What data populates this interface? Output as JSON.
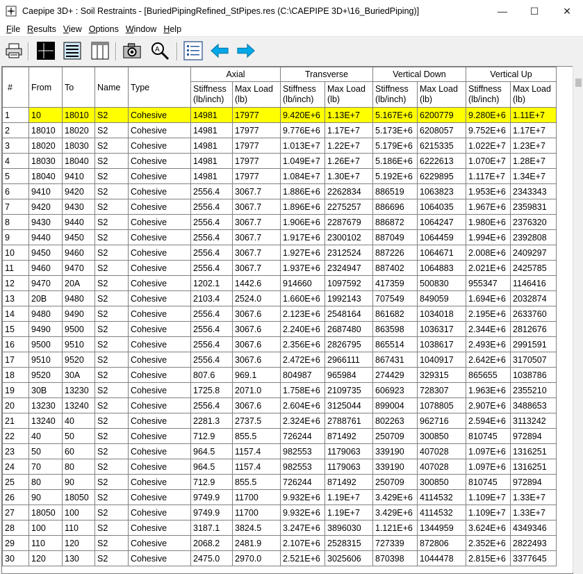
{
  "window": {
    "title": "Caepipe 3D+ : Soil Restraints -  [BuriedPipingRefined_StPipes.res (C:\\CAEPIPE 3D+\\16_BuriedPiping)]",
    "minimize": "—",
    "maximize": "☐",
    "close": "✕"
  },
  "menu": [
    "File",
    "Results",
    "View",
    "Options",
    "Window",
    "Help"
  ],
  "toolbar_icons": [
    "printer-icon",
    "grid-lines-icon",
    "document-list-icon",
    "columns-icon",
    "camera-icon",
    "zoom-icon",
    "list-icon",
    "arrow-left-icon",
    "arrow-right-icon"
  ],
  "table": {
    "headers": {
      "num": "#",
      "from": "From",
      "to": "To",
      "name": "Name",
      "type": "Type",
      "axial": "Axial",
      "transverse": "Transverse",
      "vdown": "Vertical Down",
      "vup": "Vertical Up",
      "stiffness": "Stiffness (lb/inch)",
      "maxload": "Max Load (lb)"
    },
    "rows": [
      [
        "1",
        "10",
        "18010",
        "S2",
        "Cohesive",
        "14981",
        "17977",
        "9.420E+6",
        "1.13E+7",
        "5.167E+6",
        "6200779",
        "9.280E+6",
        "1.11E+7"
      ],
      [
        "2",
        "18010",
        "18020",
        "S2",
        "Cohesive",
        "14981",
        "17977",
        "9.776E+6",
        "1.17E+7",
        "5.173E+6",
        "6208057",
        "9.752E+6",
        "1.17E+7"
      ],
      [
        "3",
        "18020",
        "18030",
        "S2",
        "Cohesive",
        "14981",
        "17977",
        "1.013E+7",
        "1.22E+7",
        "5.179E+6",
        "6215335",
        "1.022E+7",
        "1.23E+7"
      ],
      [
        "4",
        "18030",
        "18040",
        "S2",
        "Cohesive",
        "14981",
        "17977",
        "1.049E+7",
        "1.26E+7",
        "5.186E+6",
        "6222613",
        "1.070E+7",
        "1.28E+7"
      ],
      [
        "5",
        "18040",
        "9410",
        "S2",
        "Cohesive",
        "14981",
        "17977",
        "1.084E+7",
        "1.30E+7",
        "5.192E+6",
        "6229895",
        "1.117E+7",
        "1.34E+7"
      ],
      [
        "6",
        "9410",
        "9420",
        "S2",
        "Cohesive",
        "2556.4",
        "3067.7",
        "1.886E+6",
        "2262834",
        "886519",
        "1063823",
        "1.953E+6",
        "2343343"
      ],
      [
        "7",
        "9420",
        "9430",
        "S2",
        "Cohesive",
        "2556.4",
        "3067.7",
        "1.896E+6",
        "2275257",
        "886696",
        "1064035",
        "1.967E+6",
        "2359831"
      ],
      [
        "8",
        "9430",
        "9440",
        "S2",
        "Cohesive",
        "2556.4",
        "3067.7",
        "1.906E+6",
        "2287679",
        "886872",
        "1064247",
        "1.980E+6",
        "2376320"
      ],
      [
        "9",
        "9440",
        "9450",
        "S2",
        "Cohesive",
        "2556.4",
        "3067.7",
        "1.917E+6",
        "2300102",
        "887049",
        "1064459",
        "1.994E+6",
        "2392808"
      ],
      [
        "10",
        "9450",
        "9460",
        "S2",
        "Cohesive",
        "2556.4",
        "3067.7",
        "1.927E+6",
        "2312524",
        "887226",
        "1064671",
        "2.008E+6",
        "2409297"
      ],
      [
        "11",
        "9460",
        "9470",
        "S2",
        "Cohesive",
        "2556.4",
        "3067.7",
        "1.937E+6",
        "2324947",
        "887402",
        "1064883",
        "2.021E+6",
        "2425785"
      ],
      [
        "12",
        "9470",
        "20A",
        "S2",
        "Cohesive",
        "1202.1",
        "1442.6",
        "914660",
        "1097592",
        "417359",
        "500830",
        "955347",
        "1146416"
      ],
      [
        "13",
        "20B",
        "9480",
        "S2",
        "Cohesive",
        "2103.4",
        "2524.0",
        "1.660E+6",
        "1992143",
        "707549",
        "849059",
        "1.694E+6",
        "2032874"
      ],
      [
        "14",
        "9480",
        "9490",
        "S2",
        "Cohesive",
        "2556.4",
        "3067.6",
        "2.123E+6",
        "2548164",
        "861682",
        "1034018",
        "2.195E+6",
        "2633760"
      ],
      [
        "15",
        "9490",
        "9500",
        "S2",
        "Cohesive",
        "2556.4",
        "3067.6",
        "2.240E+6",
        "2687480",
        "863598",
        "1036317",
        "2.344E+6",
        "2812676"
      ],
      [
        "16",
        "9500",
        "9510",
        "S2",
        "Cohesive",
        "2556.4",
        "3067.6",
        "2.356E+6",
        "2826795",
        "865514",
        "1038617",
        "2.493E+6",
        "2991591"
      ],
      [
        "17",
        "9510",
        "9520",
        "S2",
        "Cohesive",
        "2556.4",
        "3067.6",
        "2.472E+6",
        "2966111",
        "867431",
        "1040917",
        "2.642E+6",
        "3170507"
      ],
      [
        "18",
        "9520",
        "30A",
        "S2",
        "Cohesive",
        "807.6",
        "969.1",
        "804987",
        "965984",
        "274429",
        "329315",
        "865655",
        "1038786"
      ],
      [
        "19",
        "30B",
        "13230",
        "S2",
        "Cohesive",
        "1725.8",
        "2071.0",
        "1.758E+6",
        "2109735",
        "606923",
        "728307",
        "1.963E+6",
        "2355210"
      ],
      [
        "20",
        "13230",
        "13240",
        "S2",
        "Cohesive",
        "2556.4",
        "3067.6",
        "2.604E+6",
        "3125044",
        "899004",
        "1078805",
        "2.907E+6",
        "3488653"
      ],
      [
        "21",
        "13240",
        "40",
        "S2",
        "Cohesive",
        "2281.3",
        "2737.5",
        "2.324E+6",
        "2788761",
        "802263",
        "962716",
        "2.594E+6",
        "3113242"
      ],
      [
        "22",
        "40",
        "50",
        "S2",
        "Cohesive",
        "712.9",
        "855.5",
        "726244",
        "871492",
        "250709",
        "300850",
        "810745",
        "972894"
      ],
      [
        "23",
        "50",
        "60",
        "S2",
        "Cohesive",
        "964.5",
        "1157.4",
        "982553",
        "1179063",
        "339190",
        "407028",
        "1.097E+6",
        "1316251"
      ],
      [
        "24",
        "70",
        "80",
        "S2",
        "Cohesive",
        "964.5",
        "1157.4",
        "982553",
        "1179063",
        "339190",
        "407028",
        "1.097E+6",
        "1316251"
      ],
      [
        "25",
        "80",
        "90",
        "S2",
        "Cohesive",
        "712.9",
        "855.5",
        "726244",
        "871492",
        "250709",
        "300850",
        "810745",
        "972894"
      ],
      [
        "26",
        "90",
        "18050",
        "S2",
        "Cohesive",
        "9749.9",
        "11700",
        "9.932E+6",
        "1.19E+7",
        "3.429E+6",
        "4114532",
        "1.109E+7",
        "1.33E+7"
      ],
      [
        "27",
        "18050",
        "100",
        "S2",
        "Cohesive",
        "9749.9",
        "11700",
        "9.932E+6",
        "1.19E+7",
        "3.429E+6",
        "4114532",
        "1.109E+7",
        "1.33E+7"
      ],
      [
        "28",
        "100",
        "110",
        "S2",
        "Cohesive",
        "3187.1",
        "3824.5",
        "3.247E+6",
        "3896030",
        "1.121E+6",
        "1344959",
        "3.624E+6",
        "4349346"
      ],
      [
        "29",
        "110",
        "120",
        "S2",
        "Cohesive",
        "2068.2",
        "2481.9",
        "2.107E+6",
        "2528315",
        "727339",
        "872806",
        "2.352E+6",
        "2822493"
      ],
      [
        "30",
        "120",
        "130",
        "S2",
        "Cohesive",
        "2475.0",
        "2970.0",
        "2.521E+6",
        "3025606",
        "870398",
        "1044478",
        "2.815E+6",
        "3377645"
      ]
    ]
  },
  "selected_row": 0,
  "colors": {
    "selection": "#ffff00",
    "arrow": "#00a8e8"
  }
}
